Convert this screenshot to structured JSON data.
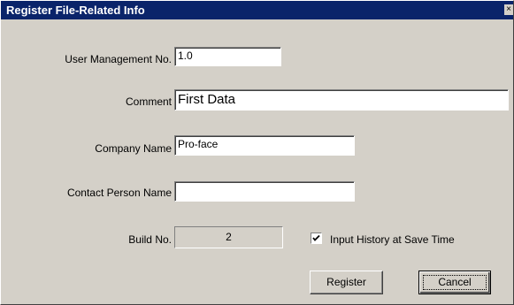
{
  "window": {
    "title": "Register File-Related Info",
    "close_glyph": "×"
  },
  "form": {
    "user_mgmt": {
      "label": "User Management No.",
      "value": "1.0"
    },
    "comment": {
      "label": "Comment",
      "value": "First Data"
    },
    "company": {
      "label": "Company Name",
      "value": "Pro-face"
    },
    "contact": {
      "label": "Contact Person Name",
      "value": ""
    },
    "build": {
      "label": "Build No.",
      "value": "2"
    },
    "history": {
      "label": "Input History at Save Time",
      "checked": true
    }
  },
  "buttons": {
    "register": "Register",
    "cancel": "Cancel"
  }
}
